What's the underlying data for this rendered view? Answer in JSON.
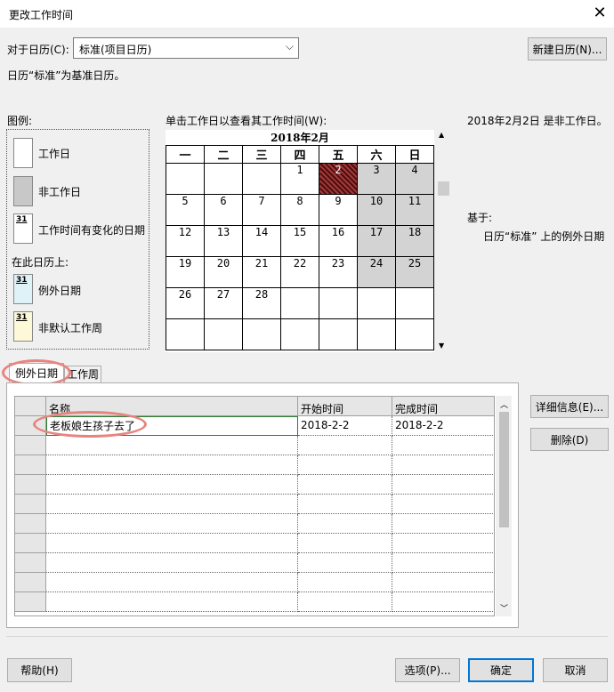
{
  "window": {
    "title": "更改工作时间",
    "close_glyph": "✕"
  },
  "calendar_for": {
    "label": "对于日历(C):",
    "selected": "标准(项目日历)"
  },
  "new_calendar_button": "新建日历(N)...",
  "base_note": "日历“标准”为基准日历。",
  "legend": {
    "title": "图例:",
    "items": [
      {
        "label": "工作日",
        "icon": "working-day-icon"
      },
      {
        "label": "非工作日",
        "icon": "nonworking-day-icon"
      },
      {
        "label": "工作时间有变化的日期",
        "icon": "changed-hours-icon",
        "num": "31"
      }
    ],
    "on_calendar_title": "在此日历上:",
    "on_calendar_items": [
      {
        "label": "例外日期",
        "icon": "exception-day-icon",
        "num": "31"
      },
      {
        "label": "非默认工作周",
        "icon": "nondefault-week-icon",
        "num": "31"
      }
    ]
  },
  "calendar": {
    "prompt": "单击工作日以查看其工作时间(W):",
    "month_title": "2018年2月",
    "weekdays": [
      "一",
      "二",
      "三",
      "四",
      "五",
      "六",
      "日"
    ],
    "weeks": [
      [
        "",
        "",
        "",
        "1",
        "2",
        "3",
        "4"
      ],
      [
        "5",
        "6",
        "7",
        "8",
        "9",
        "10",
        "11"
      ],
      [
        "12",
        "13",
        "14",
        "15",
        "16",
        "17",
        "18"
      ],
      [
        "19",
        "20",
        "21",
        "22",
        "23",
        "24",
        "25"
      ],
      [
        "26",
        "27",
        "28",
        "",
        "",
        "",
        ""
      ],
      [
        "",
        "",
        "",
        "",
        "",
        "",
        ""
      ]
    ],
    "selected_date": "2",
    "scroll_up": "▲",
    "scroll_down": "▼"
  },
  "info": {
    "status": "2018年2月2日 是非工作日。",
    "based_on_label": "基于:",
    "based_on_value": "日历“标准” 上的例外日期"
  },
  "tabs": [
    {
      "label": "例外日期",
      "active": true
    },
    {
      "label": "工作周",
      "active": false
    }
  ],
  "exceptions": {
    "columns": [
      "名称",
      "开始时间",
      "完成时间"
    ],
    "rows": [
      [
        "老板娘生孩子去了",
        "2018-2-2",
        "2018-2-2"
      ],
      [
        "",
        "",
        ""
      ],
      [
        "",
        "",
        ""
      ],
      [
        "",
        "",
        ""
      ],
      [
        "",
        "",
        ""
      ],
      [
        "",
        "",
        ""
      ],
      [
        "",
        "",
        ""
      ],
      [
        "",
        "",
        ""
      ],
      [
        "",
        "",
        ""
      ],
      [
        "",
        "",
        ""
      ]
    ]
  },
  "side_buttons": {
    "details": "详细信息(E)...",
    "delete": "删除(D)"
  },
  "footer": {
    "help": "帮助(H)",
    "options": "选项(P)...",
    "ok": "确定",
    "cancel": "取消"
  },
  "colors": {
    "nonworking": "#d3d3d3",
    "selected_day": "#7a1f1f",
    "highlight_oval": "#e88480",
    "accent": "#0078d7"
  }
}
